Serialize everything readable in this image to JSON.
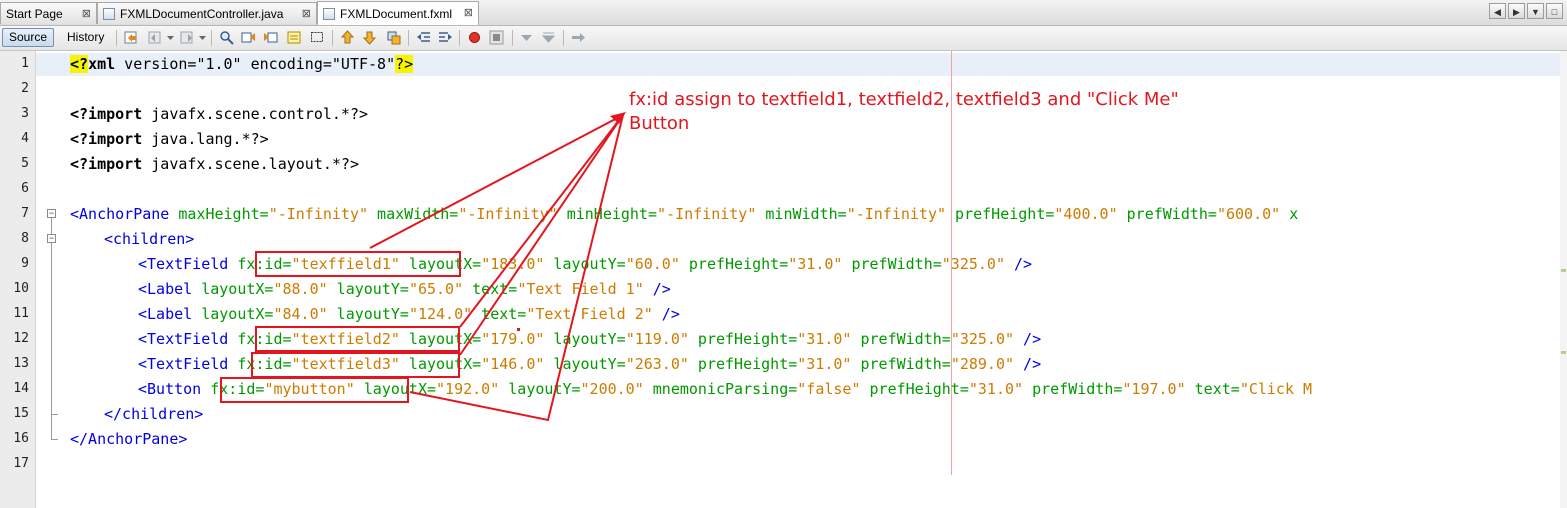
{
  "tabs": [
    {
      "label": "Start Page",
      "close": "⊠",
      "active": false
    },
    {
      "label": "FXMLDocumentController.java",
      "close": "⊠",
      "active": false
    },
    {
      "label": "FXMLDocument.fxml",
      "close": "⊠",
      "active": true
    }
  ],
  "toolbar": {
    "source_label": "Source",
    "history_label": "History"
  },
  "line_numbers": [
    "1",
    "2",
    "3",
    "4",
    "5",
    "6",
    "7",
    "8",
    "9",
    "10",
    "11",
    "12",
    "13",
    "14",
    "15",
    "16",
    "17"
  ],
  "code": {
    "l1": {
      "decl_open": "<?",
      "decl_name": "xml",
      "attr1": " version=",
      "val1": "\"1.0\"",
      "attr2": " encoding=",
      "val2": "\"UTF-8\"",
      "decl_close": "?>"
    },
    "l3": {
      "kw": "<?import",
      "rest": " javafx.scene.control.*?>"
    },
    "l4": {
      "kw": "<?import",
      "rest": " java.lang.*?>"
    },
    "l5": {
      "kw": "<?import",
      "rest": " javafx.scene.layout.*?>"
    },
    "l7": {
      "tag": "<AnchorPane",
      "a1": " maxHeight=",
      "v1": "\"-Infinity\"",
      "a2": " maxWidth=",
      "v2": "\"-Infinity\"",
      "a3": " minHeight=",
      "v3": "\"-Infinity\"",
      "a4": " minWidth=",
      "v4": "\"-Infinity\"",
      "a5": " prefHeight=",
      "v5": "\"400.0\"",
      "a6": " prefWidth=",
      "v6": "\"600.0\"",
      "a7": " x"
    },
    "l8": {
      "tag": "<children>"
    },
    "l9": {
      "tag": "<TextField",
      "a1": " fx:id=",
      "v1": "\"texffield1\"",
      "a2": " layoutX=",
      "v2": "\"183.0\"",
      "a3": " layoutY=",
      "v3": "\"60.0\"",
      "a4": " prefHeight=",
      "v4": "\"31.0\"",
      "a5": " prefWidth=",
      "v5": "\"325.0\"",
      "end": " />"
    },
    "l10": {
      "tag": "<Label",
      "a1": " layoutX=",
      "v1": "\"88.0\"",
      "a2": " layoutY=",
      "v2": "\"65.0\"",
      "a3": " text=",
      "v3": "\"Text Field 1\"",
      "end": " />"
    },
    "l11": {
      "tag": "<Label",
      "a1": " layoutX=",
      "v1": "\"84.0\"",
      "a2": " layoutY=",
      "v2": "\"124.0\"",
      "a3": " text=",
      "v3": "\"Text Field 2\"",
      "end": " />"
    },
    "l12": {
      "tag": "<TextField",
      "a1": " fx:id=",
      "v1": "\"textfield2\"",
      "a2": " layoutX=",
      "v2": "\"179.0\"",
      "a3": " layoutY=",
      "v3": "\"119.0\"",
      "a4": " prefHeight=",
      "v4": "\"31.0\"",
      "a5": " prefWidth=",
      "v5": "\"325.0\"",
      "end": " />"
    },
    "l13": {
      "tag": "<TextField",
      "a1": " fx:id=",
      "v1": "\"textfield3\"",
      "a2": " layoutX=",
      "v2": "\"146.0\"",
      "a3": " layoutY=",
      "v3": "\"263.0\"",
      "a4": " prefHeight=",
      "v4": "\"31.0\"",
      "a5": " prefWidth=",
      "v5": "\"289.0\"",
      "end": " />"
    },
    "l14": {
      "tag": "<Button",
      "a1": " fx:id=",
      "v1": "\"mybutton\"",
      "a2": " layoutX=",
      "v2": "\"192.0\"",
      "a3": " layoutY=",
      "v3": "\"200.0\"",
      "a4": " mnemonicParsing=",
      "v4": "\"false\"",
      "a5": " prefHeight=",
      "v5": "\"31.0\"",
      "a6": " prefWidth=",
      "v6": "\"197.0\"",
      "a7": " text=",
      "v7": "\"Click M"
    },
    "l15": {
      "tag": "</children>"
    },
    "l16": {
      "tag": "</AnchorPane>"
    }
  },
  "annotation": {
    "line1": "fx:id assign to textfield1, textfield2, textfield3 and \"Click Me\"",
    "line2": "Button"
  },
  "colors": {
    "annotation_red": "#e3161f",
    "tag_blue": "#0000e6",
    "attr_green": "#009900",
    "value_orange": "#ce7b00",
    "highlight_yellow": "#f5f500"
  }
}
